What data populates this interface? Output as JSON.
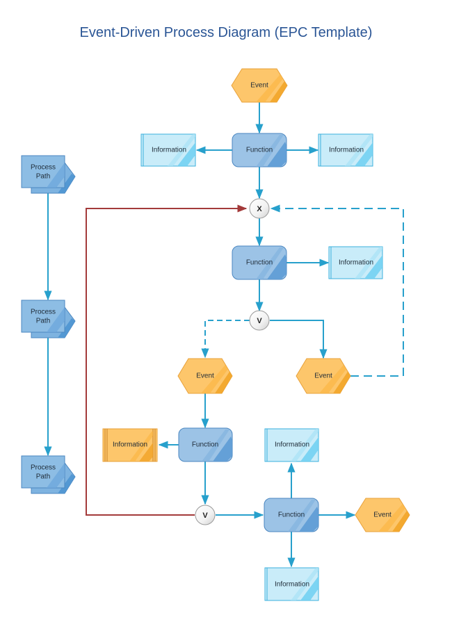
{
  "title": "Event-Driven Process Diagram (EPC Template)",
  "colors": {
    "title": "#2a5595",
    "event_fill": "#fdc66b",
    "event_stroke": "#e8a13a",
    "function_fill": "#9cc3e6",
    "function_stroke": "#4a86c0",
    "information_fill": "#c9ecf9",
    "information_stroke": "#3bb0dd",
    "information_alt_fill": "#fdc66b",
    "process_path_fill": "#8dbde4",
    "connector": "#27a0cc",
    "return_line": "#a33a3a"
  },
  "nodes": {
    "event_top": {
      "type": "event",
      "label": "Event"
    },
    "function_1": {
      "type": "function",
      "label": "Function"
    },
    "info_1_left": {
      "type": "information",
      "label": "Information"
    },
    "info_1_right": {
      "type": "information",
      "label": "Information"
    },
    "xor_gate": {
      "type": "gateway",
      "label": "X"
    },
    "function_2": {
      "type": "function",
      "label": "Function"
    },
    "info_2": {
      "type": "information",
      "label": "Information"
    },
    "or_gate_1": {
      "type": "gateway",
      "label": "V"
    },
    "event_left": {
      "type": "event",
      "label": "Event"
    },
    "event_right": {
      "type": "event",
      "label": "Event"
    },
    "function_3": {
      "type": "function",
      "label": "Function"
    },
    "info_3": {
      "type": "information",
      "label": "Information",
      "variant": "orange"
    },
    "or_gate_2": {
      "type": "gateway",
      "label": "V"
    },
    "function_4": {
      "type": "function",
      "label": "Function"
    },
    "info_4_top": {
      "type": "information",
      "label": "Information"
    },
    "info_4_bottom": {
      "type": "information",
      "label": "Information"
    },
    "event_end": {
      "type": "event",
      "label": "Event"
    },
    "process_path_1": {
      "type": "process-path",
      "label_line1": "Process",
      "label_line2": "Path"
    },
    "process_path_2": {
      "type": "process-path",
      "label_line1": "Process",
      "label_line2": "Path"
    },
    "process_path_3": {
      "type": "process-path",
      "label_line1": "Process",
      "label_line2": "Path"
    }
  },
  "edges": [
    {
      "from": "event_top",
      "to": "function_1",
      "style": "solid"
    },
    {
      "from": "function_1",
      "to": "info_1_left",
      "style": "solid"
    },
    {
      "from": "function_1",
      "to": "info_1_right",
      "style": "solid"
    },
    {
      "from": "function_1",
      "to": "xor_gate",
      "style": "solid"
    },
    {
      "from": "xor_gate",
      "to": "function_2",
      "style": "solid"
    },
    {
      "from": "function_2",
      "to": "info_2",
      "style": "solid"
    },
    {
      "from": "function_2",
      "to": "or_gate_1",
      "style": "solid"
    },
    {
      "from": "or_gate_1",
      "to": "event_left",
      "style": "dashed"
    },
    {
      "from": "or_gate_1",
      "to": "event_right",
      "style": "solid"
    },
    {
      "from": "event_right",
      "to": "xor_gate",
      "style": "dashed"
    },
    {
      "from": "event_left",
      "to": "function_3",
      "style": "solid"
    },
    {
      "from": "function_3",
      "to": "info_3",
      "style": "solid"
    },
    {
      "from": "function_3",
      "to": "or_gate_2",
      "style": "solid"
    },
    {
      "from": "or_gate_2",
      "to": "function_4",
      "style": "solid"
    },
    {
      "from": "or_gate_2",
      "to": "xor_gate",
      "style": "return"
    },
    {
      "from": "function_4",
      "to": "info_4_top",
      "style": "solid"
    },
    {
      "from": "function_4",
      "to": "info_4_bottom",
      "style": "solid"
    },
    {
      "from": "function_4",
      "to": "event_end",
      "style": "solid"
    },
    {
      "from": "process_path_1",
      "to": "process_path_2",
      "style": "solid"
    },
    {
      "from": "process_path_2",
      "to": "process_path_3",
      "style": "solid"
    }
  ]
}
